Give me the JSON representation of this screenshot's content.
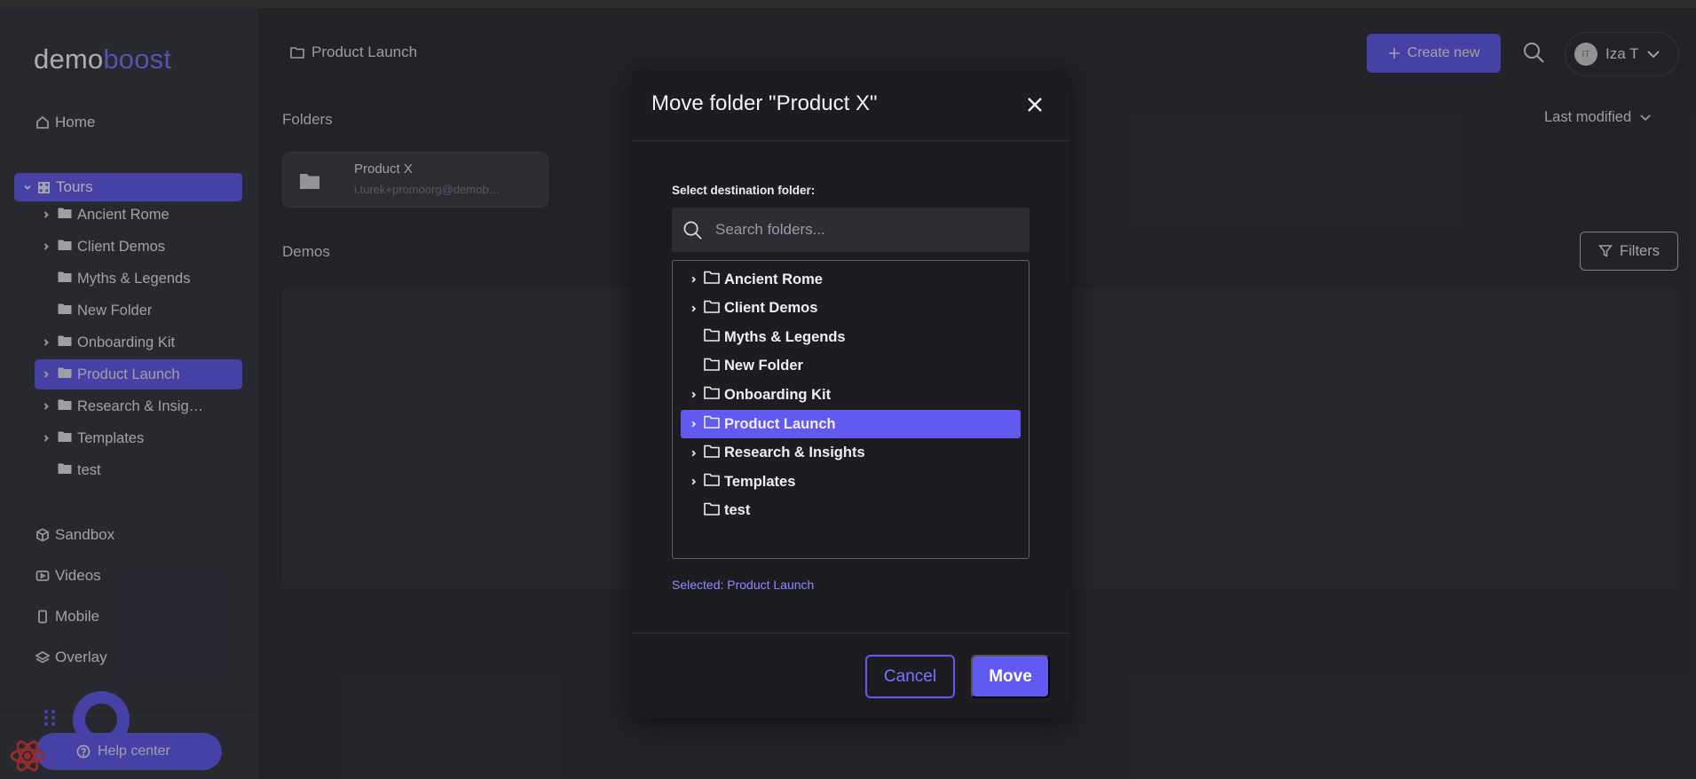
{
  "brand": {
    "part1": "demo",
    "part2": "boost"
  },
  "sidebar": {
    "home": "Home",
    "tours": "Tours",
    "tree": [
      {
        "label": "Ancient Rome",
        "expandable": true
      },
      {
        "label": "Client Demos",
        "expandable": true
      },
      {
        "label": "Myths & Legends",
        "expandable": false
      },
      {
        "label": "New Folder",
        "expandable": false
      },
      {
        "label": "Onboarding Kit",
        "expandable": true
      },
      {
        "label": "Product Launch",
        "expandable": true,
        "selected": true
      },
      {
        "label": "Research & Insigh…",
        "expandable": true
      },
      {
        "label": "Templates",
        "expandable": true
      },
      {
        "label": "test",
        "expandable": false
      }
    ],
    "sandbox": "Sandbox",
    "videos": "Videos",
    "mobile": "Mobile",
    "overlay": "Overlay",
    "help": "Help center"
  },
  "header": {
    "breadcrumb": "Product Launch",
    "create_label": "Create new",
    "user_initials": "IT",
    "user_name": "Iza T"
  },
  "main": {
    "folders_label": "Folders",
    "sort_label": "Last modified",
    "folder_card": {
      "name": "Product X",
      "owner": "i.turek+promoorg@demob…"
    },
    "demos_label": "Demos",
    "filters_label": "Filters"
  },
  "modal": {
    "title": "Move folder \"Product X\"",
    "dest_label": "Select destination folder:",
    "search_placeholder": "Search folders...",
    "folders": [
      {
        "label": "Ancient Rome",
        "expandable": true
      },
      {
        "label": "Client Demos",
        "expandable": true
      },
      {
        "label": "Myths & Legends",
        "expandable": false
      },
      {
        "label": "New Folder",
        "expandable": false
      },
      {
        "label": "Onboarding Kit",
        "expandable": true
      },
      {
        "label": "Product Launch",
        "expandable": true,
        "selected": true
      },
      {
        "label": "Research & Insights",
        "expandable": true
      },
      {
        "label": "Templates",
        "expandable": true
      },
      {
        "label": "test",
        "expandable": false
      }
    ],
    "selected_text": "Selected: Product Launch",
    "cancel_label": "Cancel",
    "move_label": "Move"
  },
  "colors": {
    "accent": "#6159f0",
    "brand_accent": "#7a74ff",
    "modal_bg": "#1d1d21",
    "sidebar_bg": "#34333d"
  }
}
